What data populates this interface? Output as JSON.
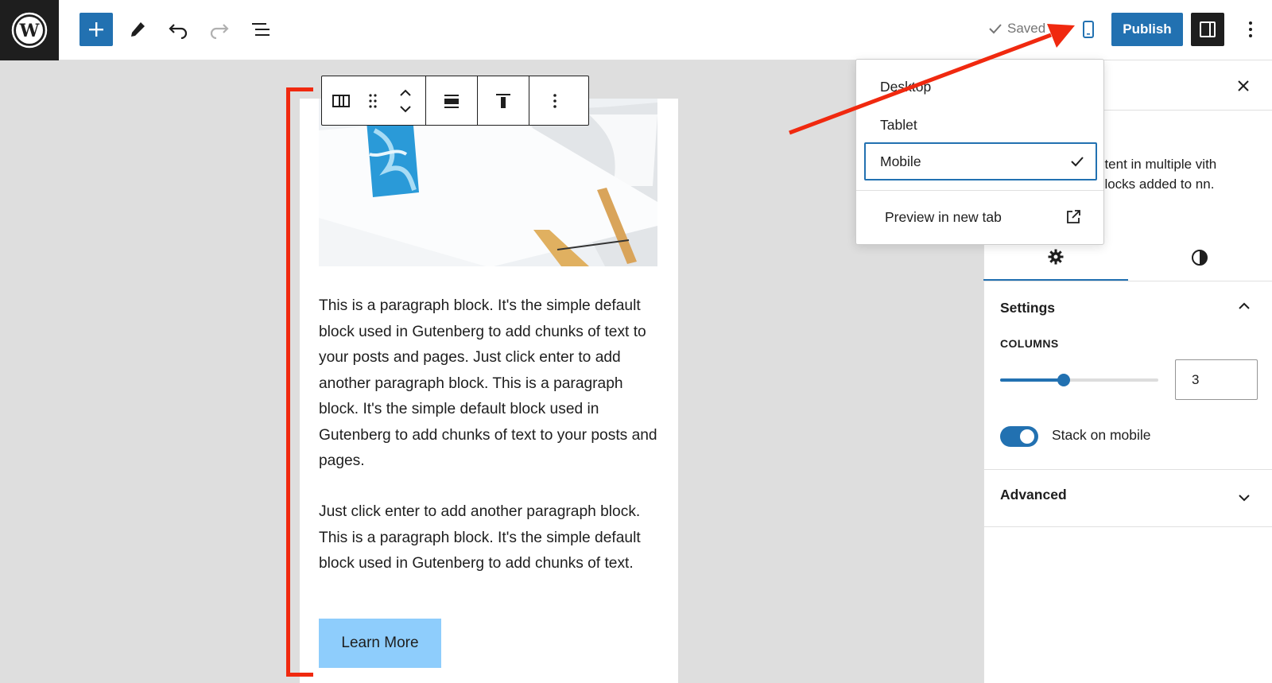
{
  "topbar": {
    "saved_label": "Saved",
    "publish_label": "Publish"
  },
  "content": {
    "paragraph_1": "This is a paragraph block. It's the simple default block used in Gutenberg to add chunks of text to your posts and pages. Just click enter to add another paragraph block. This is a paragraph block. It's the simple default block used in Gutenberg to add chunks of text to your posts and pages.",
    "paragraph_2": "Just click enter to add another paragraph block. This is a paragraph block. It's the simple default block used in Gutenberg to add chunks of text.",
    "button_label": "Learn More"
  },
  "preview_menu": {
    "items": [
      "Desktop",
      "Tablet",
      "Mobile"
    ],
    "selected": "Mobile",
    "preview_new_tab": "Preview in new tab"
  },
  "sidebar": {
    "description_partial": "ntent in multiple vith blocks added to nn.",
    "settings_title": "Settings",
    "columns_label": "COLUMNS",
    "columns_value": "3",
    "columns_slider_fraction": 0.4,
    "stack_on_mobile_label": "Stack on mobile",
    "stack_on_mobile_on": true,
    "advanced_title": "Advanced"
  },
  "colors": {
    "accent": "#2271b1",
    "annotation": "#f0290f",
    "button_bg": "#8ecdfc"
  }
}
